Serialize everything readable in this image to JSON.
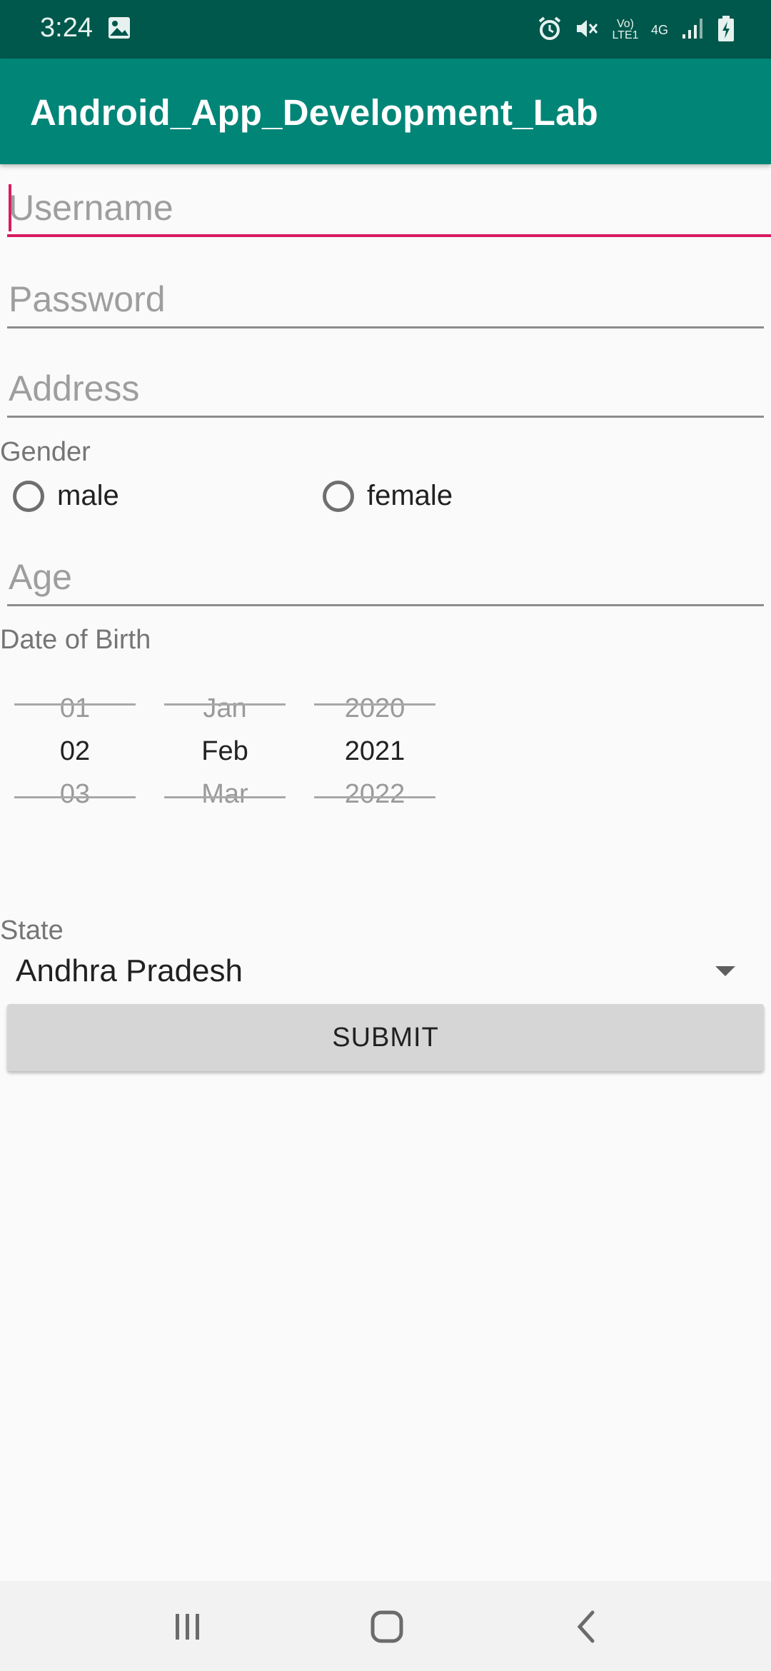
{
  "status_bar": {
    "time": "3:24",
    "network_label": "4G",
    "volte_label": "Vo) LTE1"
  },
  "app_bar": {
    "title": "Android_App_Development_Lab"
  },
  "form": {
    "username_placeholder": "Username",
    "password_placeholder": "Password",
    "address_placeholder": "Address",
    "gender_label": "Gender",
    "gender_options": [
      "male",
      "female"
    ],
    "age_placeholder": "Age",
    "dob_label": "Date of Birth",
    "date_picker": {
      "day": {
        "prev": "01",
        "selected": "02",
        "next": "03"
      },
      "month": {
        "prev": "Jan",
        "selected": "Feb",
        "next": "Mar"
      },
      "year": {
        "prev": "2020",
        "selected": "2021",
        "next": "2022"
      }
    },
    "state_label": "State",
    "state_selected": "Andhra Pradesh",
    "submit_label": "SUBMIT"
  },
  "colors": {
    "status_bar": "#00574b",
    "app_bar": "#008577",
    "accent": "#d81b60",
    "background": "#fafafa"
  }
}
